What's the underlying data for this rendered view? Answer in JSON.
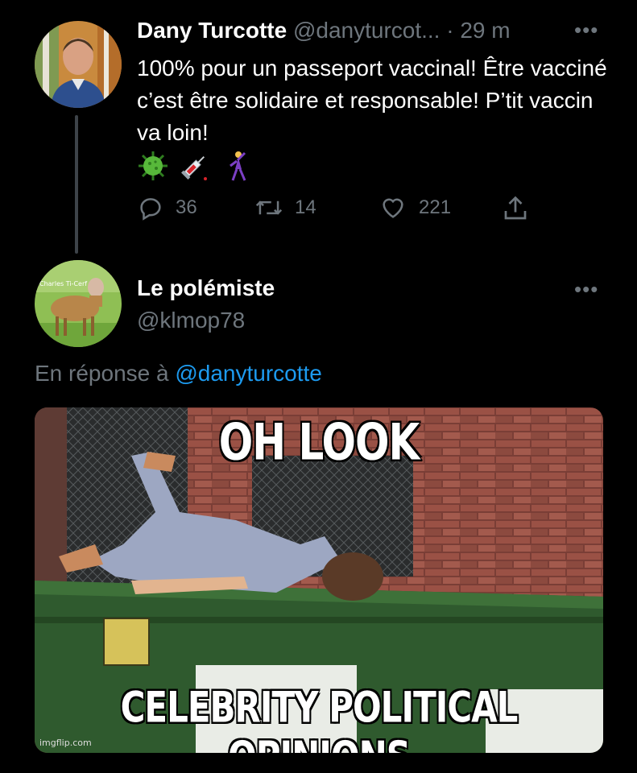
{
  "tweet1": {
    "author_name": "Dany Turcotte",
    "author_handle": "@danyturcot...",
    "separator": "·",
    "time": "29 m",
    "more": "•••",
    "text": "100% pour un passeport vaccinal! Être vacciné c’est être solidaire et responsable! P’tit vaccin va loin!",
    "emoji_icons": [
      "virus-icon",
      "syringe-icon",
      "dancer-icon"
    ],
    "stats": {
      "replies": "36",
      "retweets": "14",
      "likes": "221"
    }
  },
  "tweet2": {
    "author_name": "Le polémiste",
    "author_handle": "@klmop78",
    "more": "•••",
    "avatar_label": "Charles Ti-Cerf",
    "reply_prefix": "En réponse à",
    "reply_to": "@danyturcotte",
    "media": {
      "top_caption": "OH LOOK",
      "bottom_caption": "CELEBRITY POLITICAL OPINIONS",
      "watermark": "imgflip.com"
    }
  },
  "colors": {
    "background": "#000000",
    "muted": "#6e767d",
    "link": "#1d9bf0",
    "thread_line": "#3d4349"
  }
}
